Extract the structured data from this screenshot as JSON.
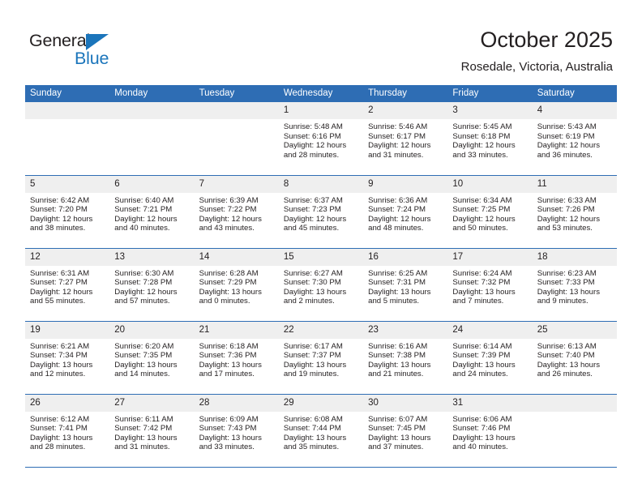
{
  "logo": {
    "word_top": "General",
    "word_bottom": "Blue",
    "triangle_color": "#1b75bb"
  },
  "header": {
    "title": "October 2025",
    "location": "Rosedale, Victoria, Australia"
  },
  "theme": {
    "header_blue": "#2e6db4",
    "day_band_gray": "#efefef",
    "text_color": "#231f20"
  },
  "weekday_headers": [
    "Sunday",
    "Monday",
    "Tuesday",
    "Wednesday",
    "Thursday",
    "Friday",
    "Saturday"
  ],
  "labels": {
    "sunrise_prefix": "Sunrise:",
    "sunset_prefix": "Sunset:",
    "daylight_prefix": "Daylight:"
  },
  "weeks": [
    [
      {
        "day": "",
        "empty": true,
        "sunrise": "",
        "sunset": "",
        "daylight_line1": "",
        "daylight_line2": ""
      },
      {
        "day": "",
        "empty": true,
        "sunrise": "",
        "sunset": "",
        "daylight_line1": "",
        "daylight_line2": ""
      },
      {
        "day": "",
        "empty": true,
        "sunrise": "",
        "sunset": "",
        "daylight_line1": "",
        "daylight_line2": ""
      },
      {
        "day": "1",
        "empty": false,
        "sunrise": "Sunrise: 5:48 AM",
        "sunset": "Sunset: 6:16 PM",
        "daylight_line1": "Daylight: 12 hours",
        "daylight_line2": "and 28 minutes."
      },
      {
        "day": "2",
        "empty": false,
        "sunrise": "Sunrise: 5:46 AM",
        "sunset": "Sunset: 6:17 PM",
        "daylight_line1": "Daylight: 12 hours",
        "daylight_line2": "and 31 minutes."
      },
      {
        "day": "3",
        "empty": false,
        "sunrise": "Sunrise: 5:45 AM",
        "sunset": "Sunset: 6:18 PM",
        "daylight_line1": "Daylight: 12 hours",
        "daylight_line2": "and 33 minutes."
      },
      {
        "day": "4",
        "empty": false,
        "sunrise": "Sunrise: 5:43 AM",
        "sunset": "Sunset: 6:19 PM",
        "daylight_line1": "Daylight: 12 hours",
        "daylight_line2": "and 36 minutes."
      }
    ],
    [
      {
        "day": "5",
        "empty": false,
        "sunrise": "Sunrise: 6:42 AM",
        "sunset": "Sunset: 7:20 PM",
        "daylight_line1": "Daylight: 12 hours",
        "daylight_line2": "and 38 minutes."
      },
      {
        "day": "6",
        "empty": false,
        "sunrise": "Sunrise: 6:40 AM",
        "sunset": "Sunset: 7:21 PM",
        "daylight_line1": "Daylight: 12 hours",
        "daylight_line2": "and 40 minutes."
      },
      {
        "day": "7",
        "empty": false,
        "sunrise": "Sunrise: 6:39 AM",
        "sunset": "Sunset: 7:22 PM",
        "daylight_line1": "Daylight: 12 hours",
        "daylight_line2": "and 43 minutes."
      },
      {
        "day": "8",
        "empty": false,
        "sunrise": "Sunrise: 6:37 AM",
        "sunset": "Sunset: 7:23 PM",
        "daylight_line1": "Daylight: 12 hours",
        "daylight_line2": "and 45 minutes."
      },
      {
        "day": "9",
        "empty": false,
        "sunrise": "Sunrise: 6:36 AM",
        "sunset": "Sunset: 7:24 PM",
        "daylight_line1": "Daylight: 12 hours",
        "daylight_line2": "and 48 minutes."
      },
      {
        "day": "10",
        "empty": false,
        "sunrise": "Sunrise: 6:34 AM",
        "sunset": "Sunset: 7:25 PM",
        "daylight_line1": "Daylight: 12 hours",
        "daylight_line2": "and 50 minutes."
      },
      {
        "day": "11",
        "empty": false,
        "sunrise": "Sunrise: 6:33 AM",
        "sunset": "Sunset: 7:26 PM",
        "daylight_line1": "Daylight: 12 hours",
        "daylight_line2": "and 53 minutes."
      }
    ],
    [
      {
        "day": "12",
        "empty": false,
        "sunrise": "Sunrise: 6:31 AM",
        "sunset": "Sunset: 7:27 PM",
        "daylight_line1": "Daylight: 12 hours",
        "daylight_line2": "and 55 minutes."
      },
      {
        "day": "13",
        "empty": false,
        "sunrise": "Sunrise: 6:30 AM",
        "sunset": "Sunset: 7:28 PM",
        "daylight_line1": "Daylight: 12 hours",
        "daylight_line2": "and 57 minutes."
      },
      {
        "day": "14",
        "empty": false,
        "sunrise": "Sunrise: 6:28 AM",
        "sunset": "Sunset: 7:29 PM",
        "daylight_line1": "Daylight: 13 hours",
        "daylight_line2": "and 0 minutes."
      },
      {
        "day": "15",
        "empty": false,
        "sunrise": "Sunrise: 6:27 AM",
        "sunset": "Sunset: 7:30 PM",
        "daylight_line1": "Daylight: 13 hours",
        "daylight_line2": "and 2 minutes."
      },
      {
        "day": "16",
        "empty": false,
        "sunrise": "Sunrise: 6:25 AM",
        "sunset": "Sunset: 7:31 PM",
        "daylight_line1": "Daylight: 13 hours",
        "daylight_line2": "and 5 minutes."
      },
      {
        "day": "17",
        "empty": false,
        "sunrise": "Sunrise: 6:24 AM",
        "sunset": "Sunset: 7:32 PM",
        "daylight_line1": "Daylight: 13 hours",
        "daylight_line2": "and 7 minutes."
      },
      {
        "day": "18",
        "empty": false,
        "sunrise": "Sunrise: 6:23 AM",
        "sunset": "Sunset: 7:33 PM",
        "daylight_line1": "Daylight: 13 hours",
        "daylight_line2": "and 9 minutes."
      }
    ],
    [
      {
        "day": "19",
        "empty": false,
        "sunrise": "Sunrise: 6:21 AM",
        "sunset": "Sunset: 7:34 PM",
        "daylight_line1": "Daylight: 13 hours",
        "daylight_line2": "and 12 minutes."
      },
      {
        "day": "20",
        "empty": false,
        "sunrise": "Sunrise: 6:20 AM",
        "sunset": "Sunset: 7:35 PM",
        "daylight_line1": "Daylight: 13 hours",
        "daylight_line2": "and 14 minutes."
      },
      {
        "day": "21",
        "empty": false,
        "sunrise": "Sunrise: 6:18 AM",
        "sunset": "Sunset: 7:36 PM",
        "daylight_line1": "Daylight: 13 hours",
        "daylight_line2": "and 17 minutes."
      },
      {
        "day": "22",
        "empty": false,
        "sunrise": "Sunrise: 6:17 AM",
        "sunset": "Sunset: 7:37 PM",
        "daylight_line1": "Daylight: 13 hours",
        "daylight_line2": "and 19 minutes."
      },
      {
        "day": "23",
        "empty": false,
        "sunrise": "Sunrise: 6:16 AM",
        "sunset": "Sunset: 7:38 PM",
        "daylight_line1": "Daylight: 13 hours",
        "daylight_line2": "and 21 minutes."
      },
      {
        "day": "24",
        "empty": false,
        "sunrise": "Sunrise: 6:14 AM",
        "sunset": "Sunset: 7:39 PM",
        "daylight_line1": "Daylight: 13 hours",
        "daylight_line2": "and 24 minutes."
      },
      {
        "day": "25",
        "empty": false,
        "sunrise": "Sunrise: 6:13 AM",
        "sunset": "Sunset: 7:40 PM",
        "daylight_line1": "Daylight: 13 hours",
        "daylight_line2": "and 26 minutes."
      }
    ],
    [
      {
        "day": "26",
        "empty": false,
        "sunrise": "Sunrise: 6:12 AM",
        "sunset": "Sunset: 7:41 PM",
        "daylight_line1": "Daylight: 13 hours",
        "daylight_line2": "and 28 minutes."
      },
      {
        "day": "27",
        "empty": false,
        "sunrise": "Sunrise: 6:11 AM",
        "sunset": "Sunset: 7:42 PM",
        "daylight_line1": "Daylight: 13 hours",
        "daylight_line2": "and 31 minutes."
      },
      {
        "day": "28",
        "empty": false,
        "sunrise": "Sunrise: 6:09 AM",
        "sunset": "Sunset: 7:43 PM",
        "daylight_line1": "Daylight: 13 hours",
        "daylight_line2": "and 33 minutes."
      },
      {
        "day": "29",
        "empty": false,
        "sunrise": "Sunrise: 6:08 AM",
        "sunset": "Sunset: 7:44 PM",
        "daylight_line1": "Daylight: 13 hours",
        "daylight_line2": "and 35 minutes."
      },
      {
        "day": "30",
        "empty": false,
        "sunrise": "Sunrise: 6:07 AM",
        "sunset": "Sunset: 7:45 PM",
        "daylight_line1": "Daylight: 13 hours",
        "daylight_line2": "and 37 minutes."
      },
      {
        "day": "31",
        "empty": false,
        "sunrise": "Sunrise: 6:06 AM",
        "sunset": "Sunset: 7:46 PM",
        "daylight_line1": "Daylight: 13 hours",
        "daylight_line2": "and 40 minutes."
      },
      {
        "day": "",
        "empty": true,
        "sunrise": "",
        "sunset": "",
        "daylight_line1": "",
        "daylight_line2": ""
      }
    ]
  ]
}
